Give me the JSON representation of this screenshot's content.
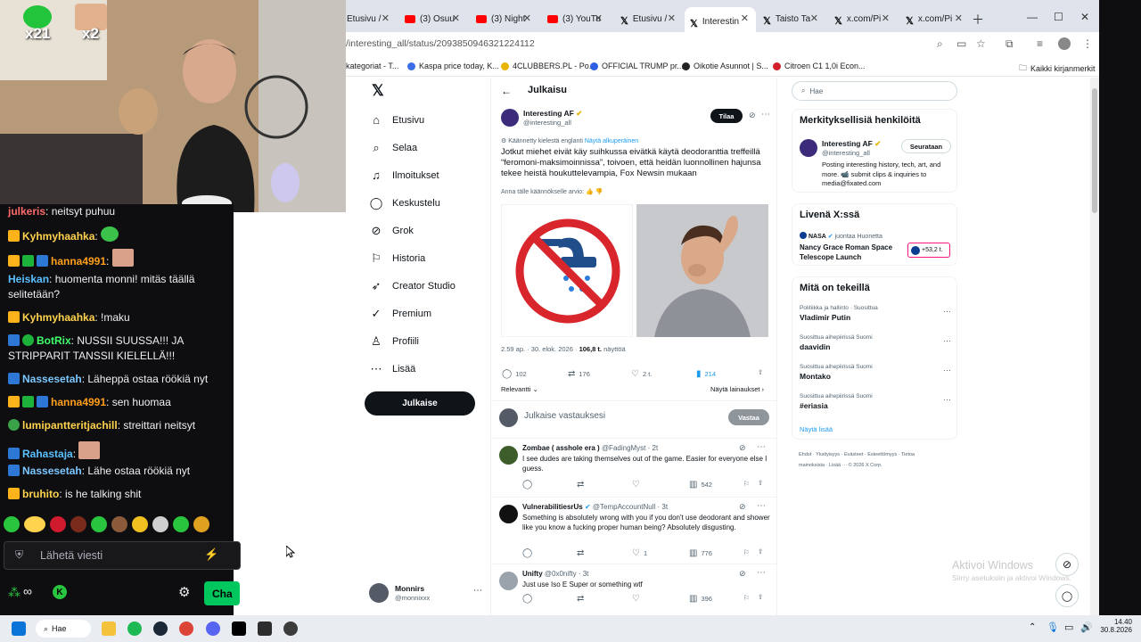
{
  "tabs": [
    {
      "label": "Etusivu /",
      "icon": "x-icon"
    },
    {
      "label": "(3) Osuu",
      "icon": "youtube-icon"
    },
    {
      "label": "(3) Night",
      "icon": "youtube-icon"
    },
    {
      "label": "(3) YouTu",
      "icon": "youtube-icon"
    },
    {
      "label": "Etusivu /",
      "icon": "x-icon"
    },
    {
      "label": "Interestin",
      "icon": "x-icon",
      "active": true
    },
    {
      "label": "Taisto Ta",
      "icon": "x-icon"
    },
    {
      "label": "x.com/Pi",
      "icon": "x-icon"
    },
    {
      "label": "x.com/Pi",
      "icon": "x-icon"
    }
  ],
  "address": {
    "url": "/interesting_all/status/2093850946321224112"
  },
  "bookmarks": [
    {
      "label": "kategoriat - T..."
    },
    {
      "label": "Kaspa price today, K..."
    },
    {
      "label": "4CLUBBERS.PL - Po..."
    },
    {
      "label": "OFFICIAL TRUMP pr..."
    },
    {
      "label": "Oikotie Asunnot | S..."
    },
    {
      "label": "Citroen C1 1,0i Econ..."
    },
    {
      "label": "Kaikki kirjanmerkit"
    }
  ],
  "nav": [
    {
      "label": "Etusivu",
      "icon": "home-icon"
    },
    {
      "label": "Selaa",
      "icon": "search-icon"
    },
    {
      "label": "Ilmoitukset",
      "icon": "bell-icon"
    },
    {
      "label": "Keskustelu",
      "icon": "message-icon"
    },
    {
      "label": "Grok",
      "icon": "grok-icon"
    },
    {
      "label": "Historia",
      "icon": "bookmark-icon"
    },
    {
      "label": "Creator Studio",
      "icon": "rocket-icon"
    },
    {
      "label": "Premium",
      "icon": "check-badge-icon"
    },
    {
      "label": "Profiili",
      "icon": "person-icon"
    },
    {
      "label": "Lisää",
      "icon": "more-icon"
    }
  ],
  "post_button": "Julkaise",
  "profile": {
    "name": "Monnirs",
    "handle": "@monnixxx"
  },
  "post": {
    "header": "Julkaisu",
    "author": "Interesting AF",
    "handle": "@interesting_all",
    "subscribe": "Tilaa",
    "translated_note": "Käännetty kielestä englanti",
    "show_original": "Näytä alkuperäinen",
    "text": "Jotkut miehet eivät käy suihkussa eivätkä käytä deodoranttia treffeillä “feromoni-maksimoinnissa”, toivoen, että heidän luonnollinen hajunsa tekee heistä houkuttelevampia, Fox Newsin mukaan",
    "rate_translation": "Anna tälle käännökselle arvio:",
    "timestamp": "2.59 ap. · 30. elok. 2026 ·",
    "views": "106,8 t.",
    "views_label": "näyttöä",
    "replies": "102",
    "reposts": "176",
    "likes": "2 t.",
    "bookmarks": "214",
    "sort": "Relevantti",
    "quotes": "Näytä lainaukset",
    "reply_placeholder": "Julkaise vastauksesi",
    "reply_button": "Vastaa"
  },
  "replies": [
    {
      "name": "Zombae ( asshole era )",
      "handle": "@FadingMyst · 2t",
      "text": "I see dudes are taking themselves out of the game. Easier for everyone else I guess.",
      "likes": "",
      "views": "542"
    },
    {
      "name": "VulnerabilitiesrUs",
      "handle": "@TempAccountNull · 3t",
      "text": "Something is absolutely wrong with you if you don't use deodorant and shower like you know a fucking proper human being? Absolutely disgusting.",
      "likes": "1",
      "views": "776"
    },
    {
      "name": "Unifty",
      "handle": "@0x0nifty · 3t",
      "text": "Just use Iso E Super or something wtf",
      "likes": "",
      "views": "396"
    }
  ],
  "right": {
    "search_placeholder": "Hae",
    "relevant_title": "Merkityksellisiä henkilöitä",
    "relevant": {
      "name": "Interesting AF",
      "handle": "@interesting_all",
      "button": "Seurataan",
      "bio": "Posting interesting history, tech, art, and more. 📹 submit clips & inquiries to media@fixated.com"
    },
    "live_title": "Livenä X:ssä",
    "live": {
      "channel": "NASA",
      "status": "juontaa Huonetta",
      "title": "Nancy Grace Roman Space Telescope Launch",
      "count": "+53,2 t."
    },
    "trends_title": "Mitä on tekeillä",
    "trends": [
      {
        "context": "Politiikka ja hallinto · Suosittua",
        "title": "Vladimir Putin"
      },
      {
        "context": "Suosittua aihepiirissä Suomi",
        "title": "daavidin"
      },
      {
        "context": "Suosittua aihepiirissä Suomi",
        "title": "Montako"
      },
      {
        "context": "Suosittua aihepiirissä Suomi",
        "title": "#eriasia"
      }
    ],
    "show_more": "Näytä lisää",
    "footer": "Ehdot · Yksityisyys · Evästeet · Esteettömyys · Tietoa mainoksista · Lisää ··· © 2026 X Corp."
  },
  "chat": {
    "overlay_counts": [
      "x21",
      "x2"
    ],
    "messages": [
      {
        "user": "julkeris",
        "text": ": neitsyt puhuu",
        "color": "#ff6b6b"
      },
      {
        "user": "Kyhmyhaahka",
        "text": ":",
        "color": "#ffd34d"
      },
      {
        "user": "hanna4991",
        "text": ":",
        "color": "#ff9f1a"
      },
      {
        "user": "Heiskan",
        "text": ": huomenta monni! mitäs täällä selitetään?",
        "color": "#5bc0ff"
      },
      {
        "user": "Kyhmyhaahka",
        "text": ": !maku",
        "color": "#ffd34d"
      },
      {
        "user": "BotRix",
        "text": ": NUSSII SUUSSA!!! JA STRIPPARIT TANSSII KIELELLÄ!!!",
        "color": "#40ff6a"
      },
      {
        "user": "Nassesetah",
        "text": ": Läheppä ostaa röökiä nyt",
        "color": "#7cc7ff"
      },
      {
        "user": "hanna4991",
        "text": ": sen huomaa",
        "color": "#ff9f1a"
      },
      {
        "user": "lumipantteritjachill",
        "text": ": streittari neitsyt",
        "color": "#ffd34d"
      },
      {
        "user": "Rahastaja",
        "text": ":",
        "color": "#5bc0ff"
      },
      {
        "user": "Nassesetah",
        "text": ": Lähe ostaa röökiä nyt",
        "color": "#7cc7ff"
      },
      {
        "user": "bruhito",
        "text": ": is he talking shit",
        "color": "#ffd34d"
      }
    ],
    "input_placeholder": "Lähetä viesti",
    "send_button": "Cha"
  },
  "windows_watermark": {
    "line1": "Aktivoi Windows",
    "line2": "Siirry asetuksiin ja aktivoi Windows."
  },
  "taskbar": {
    "search": "Hae",
    "time": "14.40",
    "date": "30.8.2026"
  }
}
